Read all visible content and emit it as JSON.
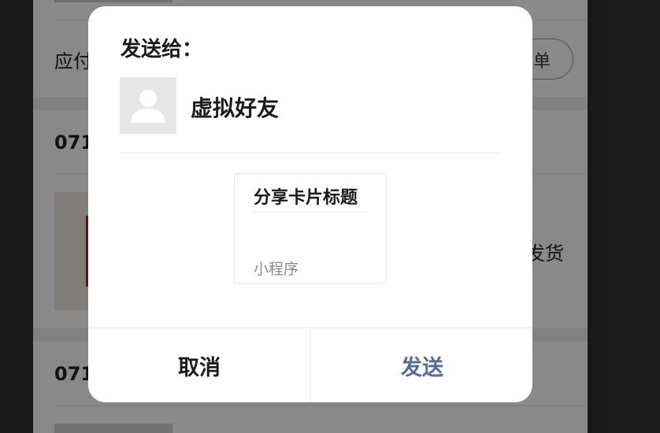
{
  "dialog": {
    "title": "发送给：",
    "recipient_name": "虚拟好友",
    "card": {
      "title": "分享卡片标题",
      "type_label": "小程序"
    },
    "cancel_label": "取消",
    "send_label": "发送",
    "send_color": "#576b95"
  },
  "background_page": {
    "pay_label_partial": "应付",
    "order_button_partial": "单",
    "order_id_partial_1": "071",
    "order_id_partial_2": "071",
    "status_partial": "发货"
  },
  "colors": {
    "overlay": "rgba(0,0,0,0.45)",
    "status_red": "#b31c1c",
    "dialog_bg": "#ffffff"
  },
  "icons": {
    "avatar": "default-user-avatar-icon"
  }
}
